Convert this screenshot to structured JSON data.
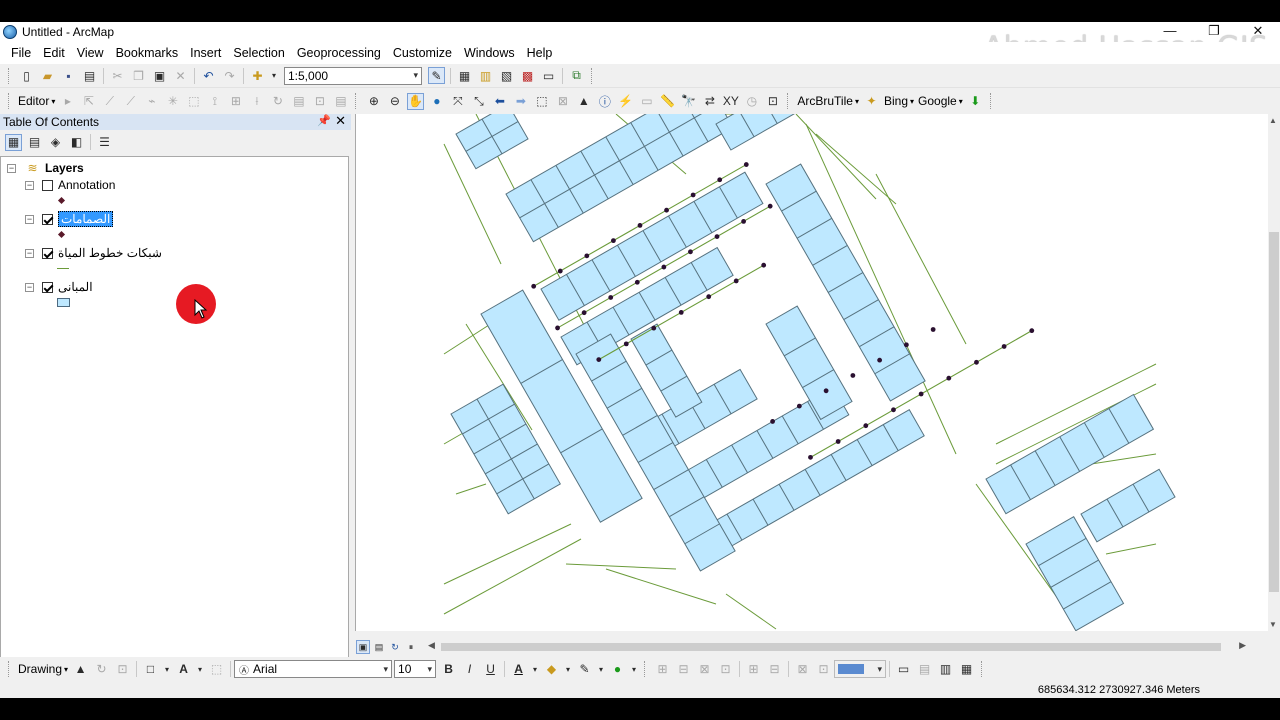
{
  "window": {
    "title": "Untitled - ArcMap",
    "controls": [
      "—",
      "❐",
      "✕"
    ]
  },
  "watermark": "Ahmed Hassan GIS",
  "menu": [
    "File",
    "Edit",
    "View",
    "Bookmarks",
    "Insert",
    "Selection",
    "Geoprocessing",
    "Customize",
    "Windows",
    "Help"
  ],
  "standard_toolbar": {
    "scale": "1:5,000"
  },
  "tools_toolbar": {
    "editor_label": "Editor",
    "arcbrutile_label": "ArcBruTile",
    "bing_label": "Bing",
    "google_label": "Google"
  },
  "toc": {
    "title": "Table Of Contents",
    "root_label": "Layers",
    "layers": [
      {
        "name": "Annotation",
        "checked": false,
        "symbol": "point"
      },
      {
        "name": "الصمامات",
        "checked": true,
        "symbol": "point",
        "selected": true
      },
      {
        "name": "شبكات خطوط المياة",
        "checked": true,
        "symbol": "line"
      },
      {
        "name": "المبانى",
        "checked": true,
        "symbol": "polygon"
      }
    ]
  },
  "drawing_toolbar": {
    "drawing_label": "Drawing",
    "font": "Arial",
    "font_size": "10",
    "bold": "B",
    "italic": "I",
    "underline": "U"
  },
  "status": {
    "coordinates": "685634.312  2730927.346 Meters"
  },
  "colors": {
    "building_fill": "#bee8ff",
    "building_outline": "#56727f",
    "pipe": "#6b9b3a",
    "valve": "#2a1030",
    "selection": "#3399ff",
    "cursor_highlight": "#e61a23"
  }
}
